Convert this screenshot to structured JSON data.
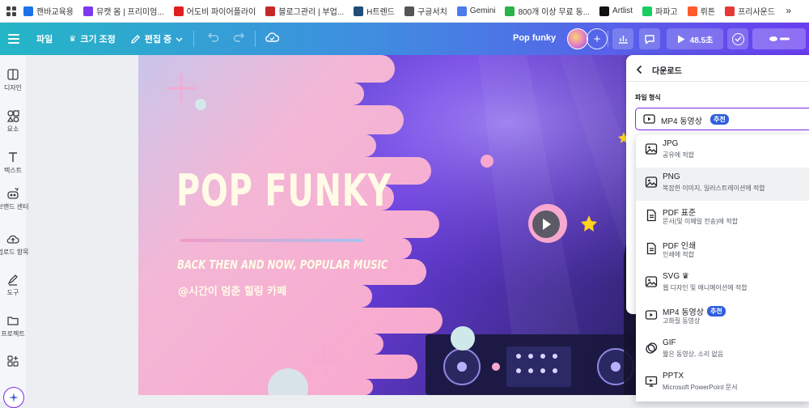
{
  "bookmarks": [
    {
      "label": "캔바교육용",
      "icon": "canva-icon",
      "color": "#1a73e8"
    },
    {
      "label": "뮤캣 몸 | 프리미엄...",
      "icon": "music-icon",
      "color": "#7c3aed"
    },
    {
      "label": "어도비 파이어플라이",
      "icon": "adobe-icon",
      "color": "#e01e1e"
    },
    {
      "label": "블로그관리 | 부업...",
      "icon": "blog-icon",
      "color": "#c62828"
    },
    {
      "label": "H트렌드",
      "icon": "trend-icon",
      "color": "#1f4e79"
    },
    {
      "label": "구글서치",
      "icon": "google-search-icon",
      "color": "#555555"
    },
    {
      "label": "Gemini",
      "icon": "gemini-icon",
      "color": "#4b7bec"
    },
    {
      "label": "800개 이상 무료 동...",
      "icon": "px-icon",
      "color": "#2bb34a"
    },
    {
      "label": "Artlist",
      "icon": "artlist-icon",
      "color": "#111111"
    },
    {
      "label": "파파고",
      "icon": "papago-icon",
      "color": "#19ce60"
    },
    {
      "label": "뤼튼",
      "icon": "wrtn-icon",
      "color": "#ff5a2c"
    },
    {
      "label": "프리사운드",
      "icon": "freesound-icon",
      "color": "#e53935"
    }
  ],
  "bookmarks_more": "»",
  "toolbar": {
    "file": "파일",
    "resize": "크기 조정",
    "editing": "편집 중",
    "design_title": "Pop funky",
    "timer": "48.5초"
  },
  "sidebar": [
    {
      "label": "디자인",
      "icon": "design-icon"
    },
    {
      "label": "요소",
      "icon": "elements-icon"
    },
    {
      "label": "텍스트",
      "icon": "text-icon"
    },
    {
      "label": "브랜드 센터",
      "icon": "brand-icon"
    },
    {
      "label": "업로드 항목",
      "icon": "upload-icon"
    },
    {
      "label": "도구",
      "icon": "tools-icon"
    },
    {
      "label": "프로젝트",
      "icon": "folder-icon"
    },
    {
      "label": "",
      "icon": "apps-icon"
    }
  ],
  "design": {
    "title": "POP FUNKY",
    "subtitle": "BACK THEN AND NOW, POPULAR MUSIC",
    "handle": "@시간이 멈춘 힐링 카페"
  },
  "download_panel": {
    "title": "다운로드",
    "file_type_label": "파일 형식",
    "selected": "MP4 동영상",
    "selected_badge": "추천"
  },
  "formats": [
    {
      "name": "JPG",
      "desc": "공유에 적합",
      "icon": "image-icon",
      "badge": ""
    },
    {
      "name": "PNG",
      "desc": "복잡한 이미지, 일러스트레이션에 적합",
      "icon": "image-icon",
      "badge": ""
    },
    {
      "name": "PDF 표준",
      "desc": "문서(및 이메일 전송)에 적합",
      "icon": "document-icon",
      "badge": ""
    },
    {
      "name": "PDF 인쇄",
      "desc": "인쇄에 적합",
      "icon": "document-icon",
      "badge": ""
    },
    {
      "name": "SVG ♛",
      "desc": "웹 디자인 및 애니메이션에 적합",
      "icon": "image-icon",
      "badge": ""
    },
    {
      "name": "MP4 동영상",
      "desc": "고화질 동영상",
      "icon": "video-icon",
      "badge": "추천"
    },
    {
      "name": "GIF",
      "desc": "짧은 동영상, 소리 없음",
      "icon": "gif-icon",
      "badge": ""
    },
    {
      "name": "PPTX",
      "desc": "Microsoft PowerPoint 문서",
      "icon": "pptx-icon",
      "badge": ""
    }
  ],
  "colors": {
    "accent": "#2f5fe0",
    "pink": "#f7a8cf",
    "purple": "#6b3df0"
  }
}
